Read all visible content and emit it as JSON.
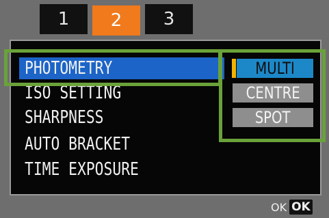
{
  "tabs": [
    {
      "label": "1",
      "active": false
    },
    {
      "label": "2",
      "active": true
    },
    {
      "label": "3",
      "active": false
    }
  ],
  "menu": {
    "items": [
      {
        "label": "PHOTOMETRY",
        "highlighted": true
      },
      {
        "label": "ISO SETTING",
        "highlighted": false
      },
      {
        "label": "SHARPNESS",
        "highlighted": false
      },
      {
        "label": "AUTO BRACKET",
        "highlighted": false
      },
      {
        "label": "TIME EXPOSURE",
        "highlighted": false
      }
    ]
  },
  "options": {
    "items": [
      {
        "label": "MULTI",
        "selected": true
      },
      {
        "label": "CENTRE",
        "selected": false
      },
      {
        "label": "SPOT",
        "selected": false
      }
    ]
  },
  "footer": {
    "ok_text": "OK",
    "ok_key": "OK"
  },
  "colors": {
    "active_tab": "#f07a1c",
    "highlight": "#1c64c8",
    "selected_option": "#1c88c8",
    "annotation": "#6aa23a",
    "marker": "#f2b400"
  }
}
